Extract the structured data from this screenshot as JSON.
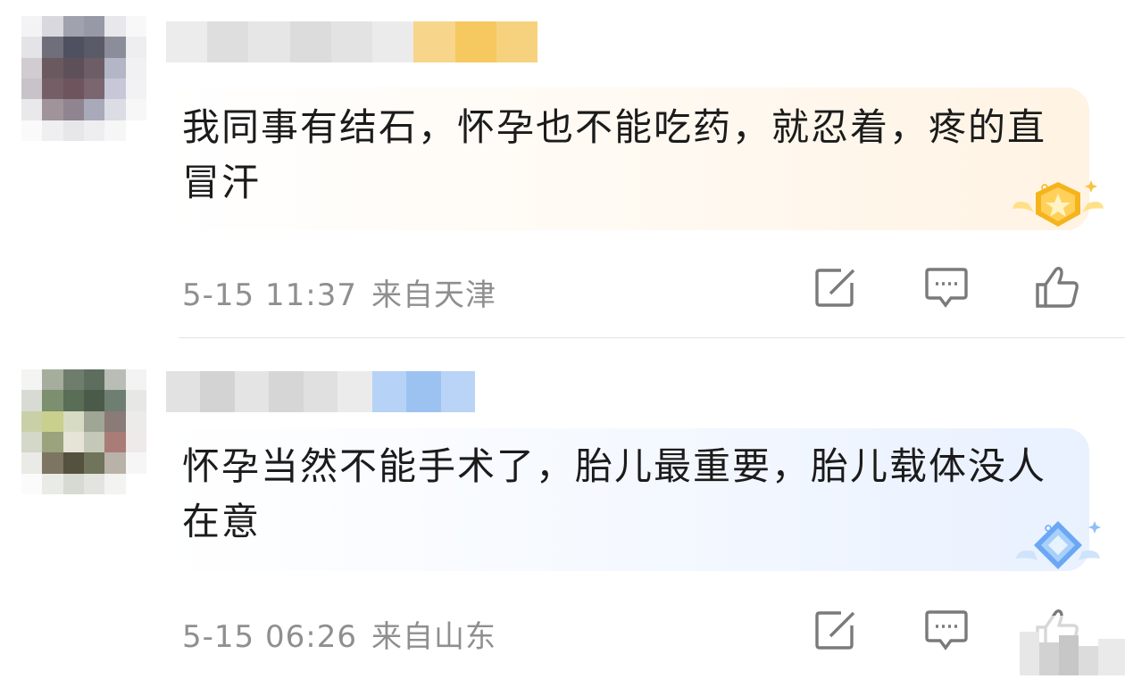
{
  "comments": [
    {
      "text": "我同事有结石，怀孕也不能吃药，就忍着，疼的直冒汗",
      "time": "5-15 11:37",
      "location": "来自天津",
      "badge_type": "gold-crown-badge"
    },
    {
      "text": "怀孕当然不能手术了，胎儿最重要，胎儿载体没人在意",
      "time": "5-15 06:26",
      "location": "来自山东",
      "badge_type": "blue-diamond-badge"
    }
  ],
  "icons": {
    "repost": "repost-icon",
    "comment": "comment-icon",
    "like": "thumbs-up-icon"
  },
  "colors": {
    "text": "#1b1b1b",
    "meta": "#8f8f8f",
    "icon": "#7a7a7a",
    "bubble_warm": "#fff3e3",
    "bubble_cool": "#e9f1ff",
    "gold": "#f6b41c",
    "diamond": "#6aa8f4"
  }
}
